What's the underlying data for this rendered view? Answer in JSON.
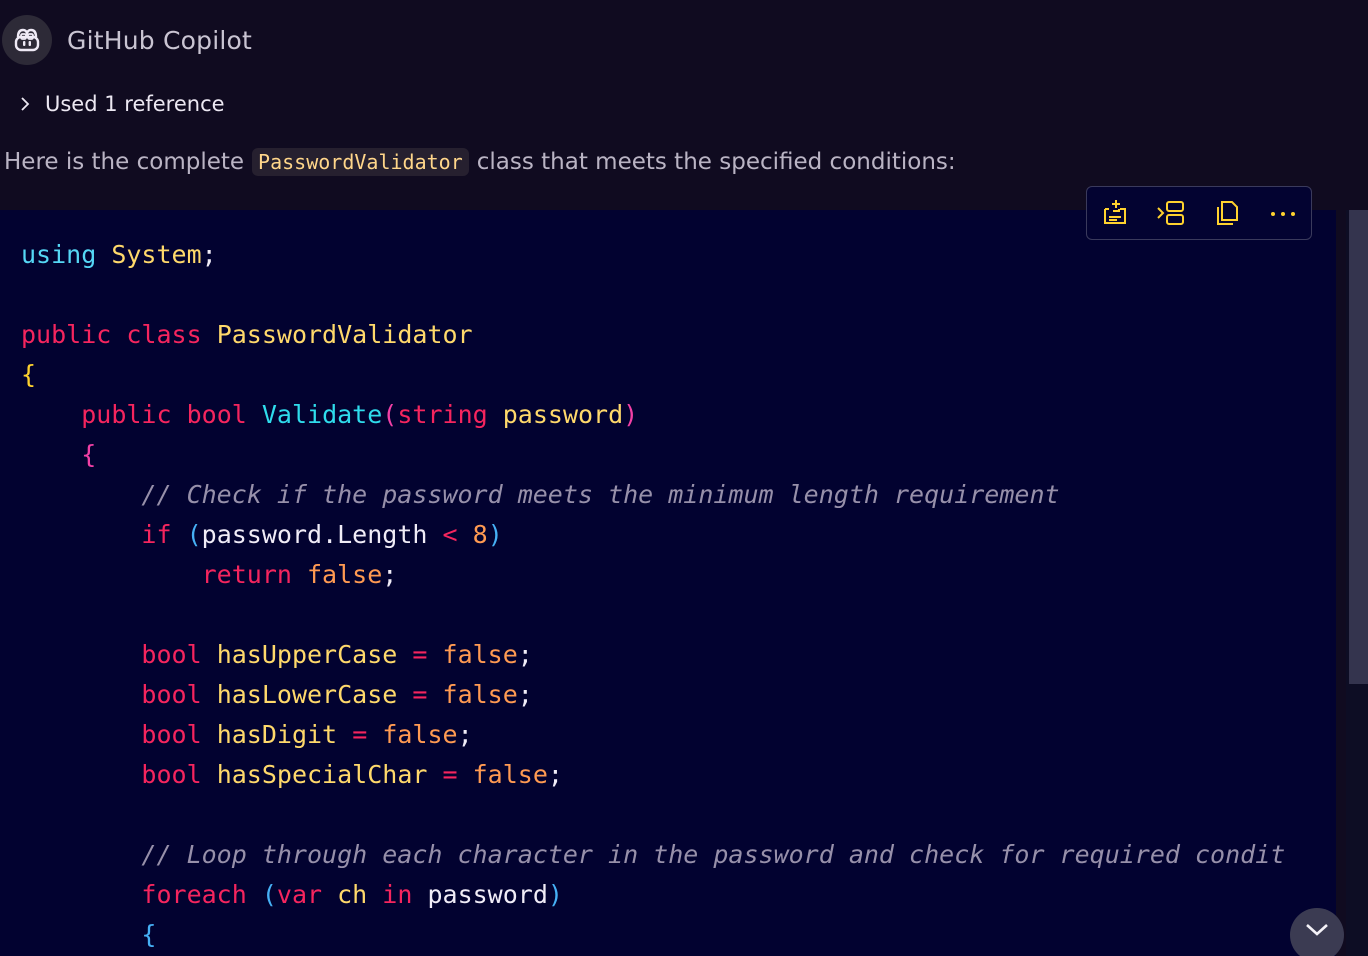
{
  "header": {
    "title": "GitHub Copilot",
    "avatar_icon": "copilot-icon"
  },
  "references": {
    "label": "Used 1 reference",
    "toggle_icon": "chevron-right-icon"
  },
  "message": {
    "before": "Here is the complete",
    "code_term": "PasswordValidator",
    "after": "class that meets the specified conditions:"
  },
  "toolbar": {
    "buttons": [
      {
        "name": "apply-in-editor-button",
        "icon": "apply-icon"
      },
      {
        "name": "insert-at-cursor-button",
        "icon": "insert-icon"
      },
      {
        "name": "copy-button",
        "icon": "copy-icon"
      },
      {
        "name": "more-actions-button",
        "icon": "ellipsis-icon"
      }
    ]
  },
  "colors": {
    "keyword_blue": "#55d7f5",
    "keyword_red": "#f5255e",
    "type_yellow": "#ffd96b",
    "method_cyan": "#2fdcec",
    "paren_magenta": "#f240a6",
    "paren_blue": "#46b0f5",
    "brace_yellow": "#ffd22e",
    "brace_violet": "#c66bf2",
    "literal_orange": "#ff9a52",
    "operator_red": "#f5255e",
    "comment": "#9790aa",
    "plain": "#f0ecf7",
    "background": "#100b20",
    "code_background": "#020230"
  },
  "code_lines": [
    [
      {
        "t": "using",
        "c": "kb"
      },
      {
        "t": " ",
        "c": "p"
      },
      {
        "t": "System",
        "c": "ty"
      },
      {
        "t": ";",
        "c": "p"
      }
    ],
    [],
    [
      {
        "t": "public",
        "c": "kr"
      },
      {
        "t": " ",
        "c": "p"
      },
      {
        "t": "class",
        "c": "kr"
      },
      {
        "t": " ",
        "c": "p"
      },
      {
        "t": "PasswordValidator",
        "c": "ty"
      }
    ],
    [
      {
        "t": "{",
        "c": "b1"
      }
    ],
    [
      {
        "t": "    ",
        "c": "p"
      },
      {
        "t": "public",
        "c": "kr"
      },
      {
        "t": " ",
        "c": "p"
      },
      {
        "t": "bool",
        "c": "kr"
      },
      {
        "t": " ",
        "c": "p"
      },
      {
        "t": "Validate",
        "c": "fn"
      },
      {
        "t": "(",
        "c": "b2"
      },
      {
        "t": "string",
        "c": "kr"
      },
      {
        "t": " ",
        "c": "p"
      },
      {
        "t": "password",
        "c": "ty"
      },
      {
        "t": ")",
        "c": "b2"
      }
    ],
    [
      {
        "t": "    ",
        "c": "p"
      },
      {
        "t": "{",
        "c": "b2"
      }
    ],
    [
      {
        "t": "        ",
        "c": "p"
      },
      {
        "t": "// Check if the password meets the minimum length requirement",
        "c": "cm"
      }
    ],
    [
      {
        "t": "        ",
        "c": "p"
      },
      {
        "t": "if",
        "c": "kr"
      },
      {
        "t": " ",
        "c": "p"
      },
      {
        "t": "(",
        "c": "b3"
      },
      {
        "t": "password.Length",
        "c": "p"
      },
      {
        "t": " ",
        "c": "p"
      },
      {
        "t": "<",
        "c": "op"
      },
      {
        "t": " ",
        "c": "p"
      },
      {
        "t": "8",
        "c": "lit"
      },
      {
        "t": ")",
        "c": "b3"
      }
    ],
    [
      {
        "t": "            ",
        "c": "p"
      },
      {
        "t": "return",
        "c": "kr"
      },
      {
        "t": " ",
        "c": "p"
      },
      {
        "t": "false",
        "c": "lit"
      },
      {
        "t": ";",
        "c": "p"
      }
    ],
    [],
    [
      {
        "t": "        ",
        "c": "p"
      },
      {
        "t": "bool",
        "c": "kr"
      },
      {
        "t": " ",
        "c": "p"
      },
      {
        "t": "hasUpperCase",
        "c": "ty"
      },
      {
        "t": " ",
        "c": "p"
      },
      {
        "t": "=",
        "c": "op"
      },
      {
        "t": " ",
        "c": "p"
      },
      {
        "t": "false",
        "c": "lit"
      },
      {
        "t": ";",
        "c": "p"
      }
    ],
    [
      {
        "t": "        ",
        "c": "p"
      },
      {
        "t": "bool",
        "c": "kr"
      },
      {
        "t": " ",
        "c": "p"
      },
      {
        "t": "hasLowerCase",
        "c": "ty"
      },
      {
        "t": " ",
        "c": "p"
      },
      {
        "t": "=",
        "c": "op"
      },
      {
        "t": " ",
        "c": "p"
      },
      {
        "t": "false",
        "c": "lit"
      },
      {
        "t": ";",
        "c": "p"
      }
    ],
    [
      {
        "t": "        ",
        "c": "p"
      },
      {
        "t": "bool",
        "c": "kr"
      },
      {
        "t": " ",
        "c": "p"
      },
      {
        "t": "hasDigit",
        "c": "ty"
      },
      {
        "t": " ",
        "c": "p"
      },
      {
        "t": "=",
        "c": "op"
      },
      {
        "t": " ",
        "c": "p"
      },
      {
        "t": "false",
        "c": "lit"
      },
      {
        "t": ";",
        "c": "p"
      }
    ],
    [
      {
        "t": "        ",
        "c": "p"
      },
      {
        "t": "bool",
        "c": "kr"
      },
      {
        "t": " ",
        "c": "p"
      },
      {
        "t": "hasSpecialChar",
        "c": "ty"
      },
      {
        "t": " ",
        "c": "p"
      },
      {
        "t": "=",
        "c": "op"
      },
      {
        "t": " ",
        "c": "p"
      },
      {
        "t": "false",
        "c": "lit"
      },
      {
        "t": ";",
        "c": "p"
      }
    ],
    [],
    [
      {
        "t": "        ",
        "c": "p"
      },
      {
        "t": "// Loop through each character in the password and check for required condit",
        "c": "cm"
      }
    ],
    [
      {
        "t": "        ",
        "c": "p"
      },
      {
        "t": "foreach",
        "c": "kr"
      },
      {
        "t": " ",
        "c": "p"
      },
      {
        "t": "(",
        "c": "b3"
      },
      {
        "t": "var",
        "c": "kr"
      },
      {
        "t": " ",
        "c": "p"
      },
      {
        "t": "ch",
        "c": "ty"
      },
      {
        "t": " ",
        "c": "p"
      },
      {
        "t": "in",
        "c": "kr"
      },
      {
        "t": " ",
        "c": "p"
      },
      {
        "t": "password",
        "c": "p"
      },
      {
        "t": ")",
        "c": "b3"
      }
    ],
    [
      {
        "t": "        ",
        "c": "p"
      },
      {
        "t": "{",
        "c": "b3"
      }
    ]
  ],
  "scroll_down_icon": "chevron-down-icon"
}
